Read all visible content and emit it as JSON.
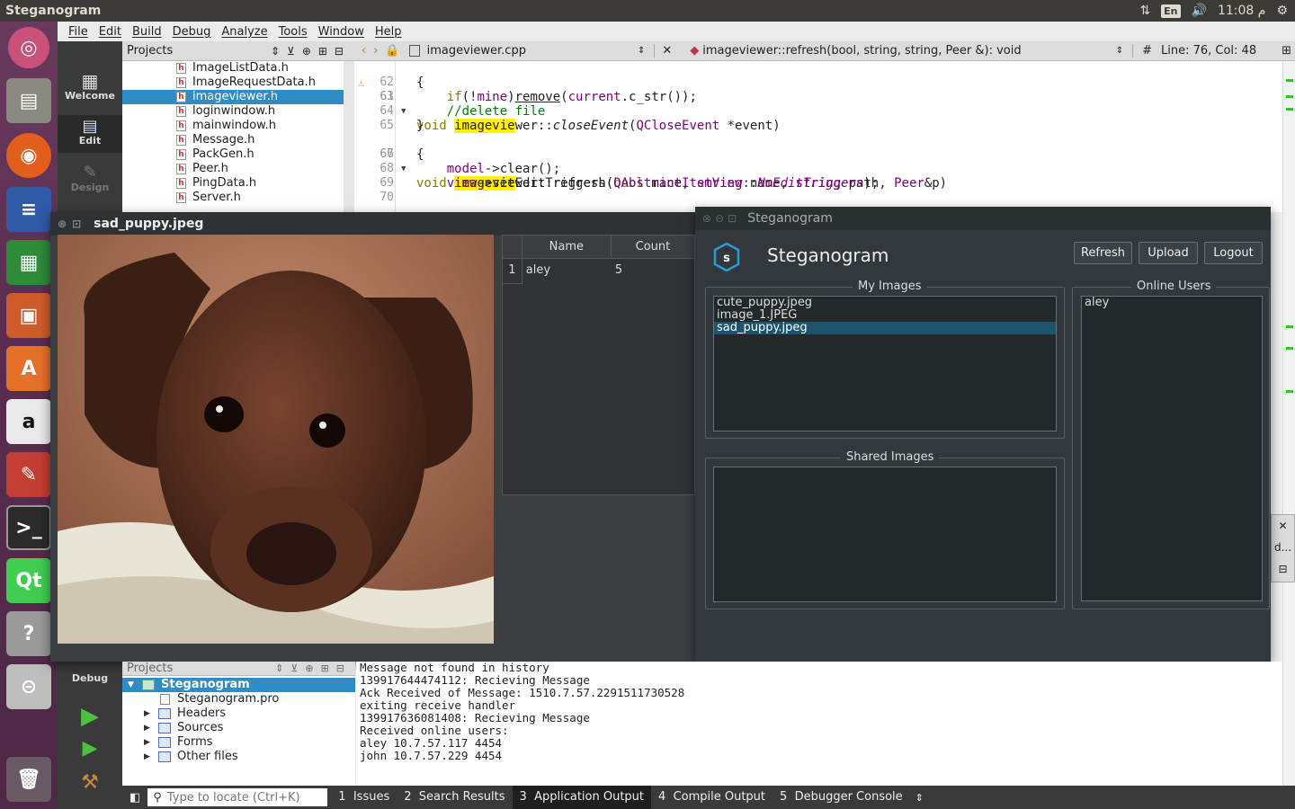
{
  "topbar": {
    "app_title": "Steganogram",
    "lang": "En",
    "clock": "11:08 م"
  },
  "menu": [
    "File",
    "Edit",
    "Build",
    "Debug",
    "Analyze",
    "Tools",
    "Window",
    "Help"
  ],
  "modes": {
    "welcome": "Welcome",
    "edit": "Edit",
    "design": "Design",
    "debug": "Debug"
  },
  "projects_pane": {
    "title": "Projects",
    "files": [
      "ImageListData.h",
      "ImageRequestData.h",
      "imageviewer.h",
      "loginwindow.h",
      "mainwindow.h",
      "Message.h",
      "PackGen.h",
      "Peer.h",
      "PingData.h",
      "Server.h"
    ],
    "selected_index": 2
  },
  "editor": {
    "file": "imageviewer.cpp",
    "function": "imageviewer::refresh(bool, string, string, Peer &): void",
    "hash": "#",
    "position": "Line: 76, Col: 48",
    "lines": [
      "61",
      "62",
      "63",
      "64",
      "65",
      "66",
      "67",
      "68",
      "69",
      "70"
    ],
    "code": {
      "l61_a": "void ",
      "l61_h": "imagevie",
      "l61_b": "wer",
      "l61_c": "::",
      "l61_d": "closeEvent",
      "l61_e": "(",
      "l61_f": "QCloseEvent",
      "l61_g": " *event)",
      "l62": "{",
      "l63_a": "    ",
      "l63_b": "if",
      "l63_c": "(!",
      "l63_d": "mine",
      "l63_e": ")",
      "l63_f": "remove",
      "l63_g": "(",
      "l63_h": "current",
      "l63_i": ".c_str());",
      "l64": "    //delete file",
      "l65": "}",
      "l66_a": "void ",
      "l66_h": "imagevie",
      "l66_b": "wer",
      "l66_c": "::refresh(",
      "l66_d": "bool",
      "l66_e": " mine, ",
      "l66_f": "string",
      "l66_g": " name, ",
      "l66_i": "string",
      "l66_j": " path, ",
      "l66_k": "Peer",
      "l66_l": "&p)",
      "l67": "{",
      "l68_a": "    ",
      "l68_b": "model",
      "l68_c": "->clear();",
      "l69_a": "    ",
      "l69_b": "view",
      "l69_c": "->setEditTriggers(",
      "l69_d": "QAbstractItemView",
      "l69_e": "::",
      "l69_f": "NoEditTriggers",
      "l69_g": ");"
    }
  },
  "image_window": {
    "title": "sad_puppy.jpeg",
    "table": {
      "headers": [
        "Name",
        "Count"
      ],
      "rows": [
        {
          "index": "1",
          "name": "aley",
          "count": "5"
        }
      ]
    }
  },
  "steg_window": {
    "title": "Steganogram",
    "heading": "Steganogram",
    "buttons": {
      "refresh": "Refresh",
      "upload": "Upload",
      "logout": "Logout"
    },
    "my_images": {
      "label": "My Images",
      "items": [
        "cute_puppy.jpeg",
        "image_1.JPEG",
        "sad_puppy.jpeg"
      ],
      "selected_index": 2
    },
    "shared_images": {
      "label": "Shared Images",
      "items": []
    },
    "online_users": {
      "label": "Online Users",
      "items": [
        "aley"
      ]
    }
  },
  "bottom_projects": {
    "title": "Projects",
    "root": "Steganogram",
    "pro_file": "Steganogram.pro",
    "folders": [
      "Headers",
      "Sources",
      "Forms",
      "Other files"
    ]
  },
  "output_lines": [
    "Message not found in history",
    "139917644474112: Recieving Message",
    "Ack Received of Message: 1510.7.57.2291511730528",
    "exiting receive handler",
    "139917636081408: Recieving Message",
    "Received online users:",
    "aley 10.7.57.117 4454",
    "john 10.7.57.229 4454"
  ],
  "side_panel": {
    "label": "d..."
  },
  "statusbar": {
    "locate_placeholder": "Type to locate (Ctrl+K)",
    "tabs": [
      {
        "num": "1",
        "label": "Issues"
      },
      {
        "num": "2",
        "label": "Search Results"
      },
      {
        "num": "3",
        "label": "Application Output"
      },
      {
        "num": "4",
        "label": "Compile Output"
      },
      {
        "num": "5",
        "label": "Debugger Console"
      }
    ],
    "active_tab_index": 2
  }
}
